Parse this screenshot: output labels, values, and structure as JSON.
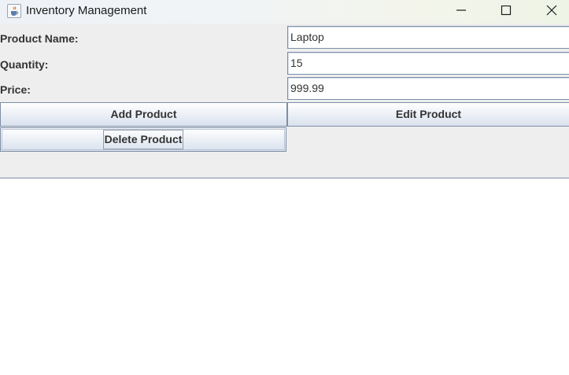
{
  "window": {
    "title": "Inventory Management",
    "icons": {
      "app": "java-cup-icon",
      "minimize": "minimize-icon",
      "maximize": "maximize-icon",
      "close": "close-icon"
    }
  },
  "form": {
    "product_name_label": "Product Name:",
    "product_name_value": "Laptop",
    "quantity_label": "Quantity:",
    "quantity_value": "15",
    "price_label": "Price:",
    "price_value": "999.99"
  },
  "buttons": {
    "add": "Add Product",
    "edit": "Edit Product",
    "delete": "Delete Product"
  },
  "colors": {
    "panel_background": "#eeeeee",
    "button_border": "#7d8ea6",
    "text": "#333333"
  }
}
